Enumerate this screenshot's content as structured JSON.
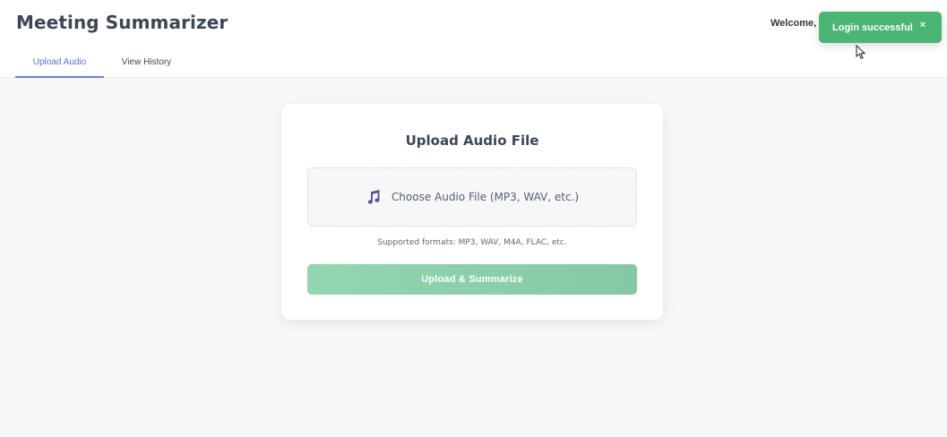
{
  "header": {
    "app_title": "Meeting Summarizer",
    "welcome_text": "Welcome, ",
    "tabs": [
      {
        "label": "Upload Audio",
        "active": true
      },
      {
        "label": "View History",
        "active": false
      }
    ]
  },
  "upload_card": {
    "title": "Upload Audio File",
    "dropzone_icon": "music-note-icon",
    "dropzone_label": "Choose Audio File (MP3, WAV, etc.)",
    "supported_formats": "Supported formats: MP3, WAV, M4A, FLAC, etc.",
    "upload_button_label": "Upload & Summarize"
  },
  "toast": {
    "message": "Login successful",
    "close_label": "×"
  },
  "colors": {
    "accent": "#6f82d8",
    "success": "#4bb574",
    "button": "#8ccfab",
    "icon": "#5b4f9b"
  }
}
